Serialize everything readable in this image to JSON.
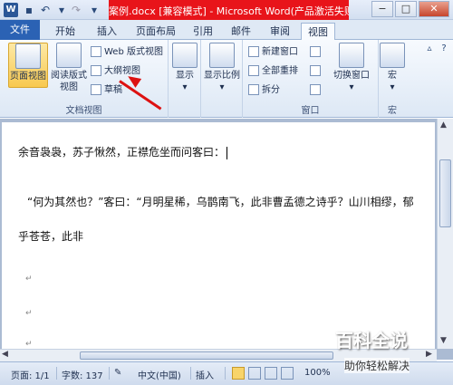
{
  "titlebar": {
    "title": "案例.docx [兼容模式] - Microsoft Word(产品激活失败)",
    "word_icon": "W",
    "minimize": "−",
    "maximize": "□",
    "close": "✕"
  },
  "tabs": [
    "文件",
    "开始",
    "插入",
    "页面布局",
    "引用",
    "邮件",
    "审阅",
    "视图"
  ],
  "ribbon": {
    "doc_views": {
      "page_view": "页面视图",
      "read_view_line1": "阅读版式",
      "read_view_line2": "视图",
      "web_view": "Web 版式视图",
      "outline_view": "大纲视图",
      "draft": "草稿",
      "group_label": "文档视图"
    },
    "show": "显示",
    "zoom": "显示比例",
    "window": {
      "new_window": "新建窗口",
      "arrange_all": "全部重排",
      "split": "拆分",
      "switch_window": "切换窗口",
      "group_label": "窗口"
    },
    "macro": {
      "label": "宏",
      "group_label": "宏"
    }
  },
  "document": {
    "line1": "余音袅袅，苏子愀然，正襟危坐而问客曰：",
    "line2": "“何为其然也？”客曰：“月明星稀，乌鹊南飞，此非曹孟德之诗乎？山川相缪，郁",
    "line3": "乎苍苍，此非",
    "para_mark": "↵"
  },
  "statusbar": {
    "page": "页面: 1/1",
    "words": "字数: 137",
    "language": "中文(中国)",
    "insert": "插入",
    "zoom": "100%"
  },
  "watermark": {
    "title": "百科全说",
    "subtitle": "助你轻松解决"
  }
}
